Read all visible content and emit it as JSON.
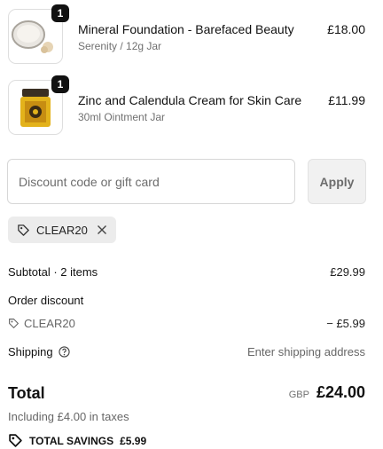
{
  "items": [
    {
      "name": "Mineral Foundation - Barefaced Beauty",
      "variant": "Serenity / 12g Jar",
      "price": "£18.00",
      "qty": "1",
      "image": "foundation-jar-icon"
    },
    {
      "name": "Zinc and Calendula Cream for Skin Care",
      "variant": "30ml Ointment Jar",
      "price": "£11.99",
      "qty": "1",
      "image": "cream-jar-icon"
    }
  ],
  "discount": {
    "placeholder": "Discount code or gift card",
    "apply_label": "Apply"
  },
  "applied_code": {
    "code": "CLEAR20"
  },
  "summary": {
    "subtotal_label": "Subtotal · 2 items",
    "subtotal_value": "£29.99",
    "order_discount_label": "Order discount",
    "discount_code": "CLEAR20",
    "discount_value": "− £5.99",
    "shipping_label": "Shipping",
    "shipping_value": "Enter shipping address",
    "total_label": "Total",
    "currency": "GBP",
    "total_value": "£24.00",
    "taxes_note": "Including £4.00 in taxes",
    "savings_label": "TOTAL SAVINGS",
    "savings_value": "£5.99"
  }
}
